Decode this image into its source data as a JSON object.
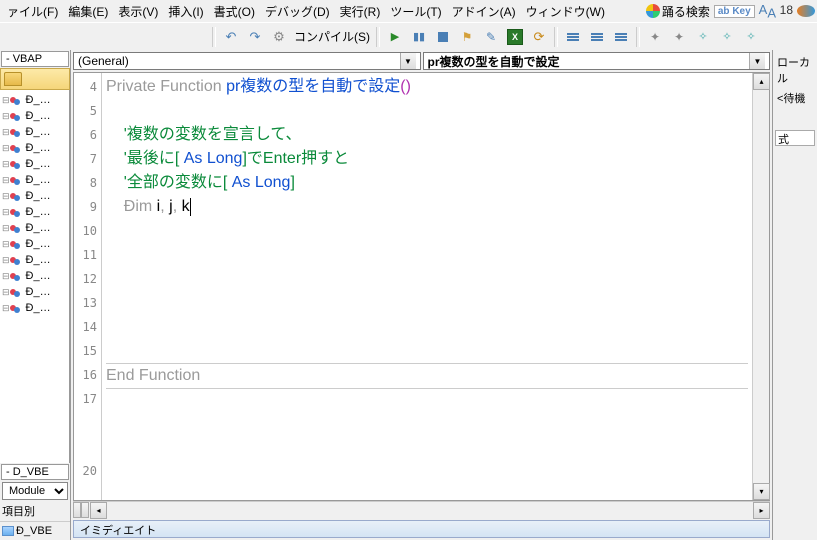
{
  "menu": {
    "file": "ァイル(F)",
    "edit": "編集(E)",
    "view": "表示(V)",
    "insert": "挿入(I)",
    "format": "書式(O)",
    "debug": "デバッグ(D)",
    "run": "実行(R)",
    "tools": "ツール(T)",
    "addin": "アドイン(A)",
    "window": "ウィンドウ(W)",
    "odoru": "踊る検索",
    "key": "Key",
    "aa": "A",
    "aa_sub": "A",
    "aa_num": "18"
  },
  "toolbar": {
    "compile": "コンパイル(S)",
    "excel": "X"
  },
  "left": {
    "tab_vbap": "- VBAP",
    "tree_items": [
      "Đ_…",
      "Đ_…",
      "Đ_…",
      "Đ_…",
      "Đ_…",
      "Đ_…",
      "Đ_…",
      "Đ_…",
      "Đ_…",
      "Đ_…",
      "Đ_…",
      "Đ_…",
      "Đ_…",
      "Đ_…"
    ],
    "tab_dvbe": "- D_VBE",
    "combo": "Module",
    "section": "項目別",
    "proj_item": "Đ_VBE"
  },
  "dropdowns": {
    "left": "(General)",
    "right": "pr複数の型を自動で設定"
  },
  "code": {
    "lines": {
      "4": {
        "a": "Private Function ",
        "b": "pr複数の型を自動で設定",
        "c": "()"
      },
      "5": "",
      "6": "    '複数の変数を宣言して、",
      "7a": "    '最後に[ ",
      "7b": "As Long",
      "7c": "]でEnter押すと",
      "8a": "    '全部の変数に[ ",
      "8b": "As Long",
      "8c": "]",
      "9a": "    Đim ",
      "9b": "i",
      "9c": ", ",
      "9d": "j",
      "9e": ", ",
      "9f": "k",
      "16": "End Function"
    },
    "line_nums": [
      "4",
      "5",
      "6",
      "7",
      "8",
      "9",
      "10",
      "11",
      "12",
      "13",
      "14",
      "15",
      "16",
      "17",
      "",
      "",
      "20"
    ]
  },
  "immediate": "イミディエイト",
  "right": {
    "local": "ローカル",
    "wait": "<待機",
    "expr": "式"
  }
}
